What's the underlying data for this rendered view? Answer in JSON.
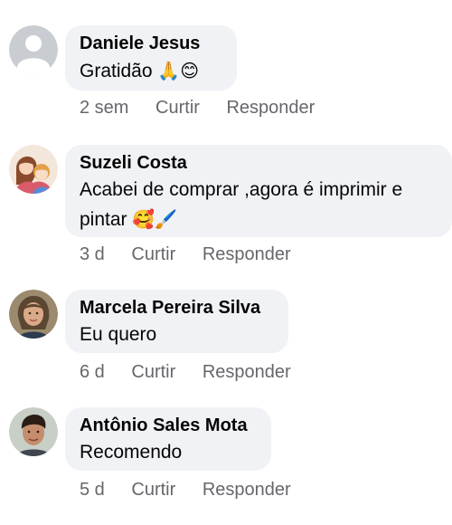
{
  "comments": [
    {
      "author": "Daniele Jesus",
      "text": "Gratidão",
      "emojis": "🙏😊",
      "time": "2 sem",
      "like_label": "Curtir",
      "reply_label": "Responder",
      "avatar": "default-avatar-icon"
    },
    {
      "author": "Suzeli Costa",
      "text": "Acabei de comprar ,agora é imprimir e pintar",
      "emojis": "🥰🖌️",
      "time": "3 d",
      "like_label": "Curtir",
      "reply_label": "Responder",
      "avatar": "illustrated-family-avatar"
    },
    {
      "author": "Marcela Pereira Silva",
      "text": "Eu quero",
      "time": "6 d",
      "like_label": "Curtir",
      "reply_label": "Responder",
      "avatar": "woman-photo-avatar"
    },
    {
      "author": "Antônio Sales Mota",
      "text": "Recomendo",
      "time": "5 d",
      "like_label": "Curtir",
      "reply_label": "Responder",
      "avatar": "man-photo-avatar"
    }
  ],
  "colors": {
    "bubble_bg": "#f0f2f5",
    "meta_text": "#65676b",
    "primary_text": "#050505"
  }
}
